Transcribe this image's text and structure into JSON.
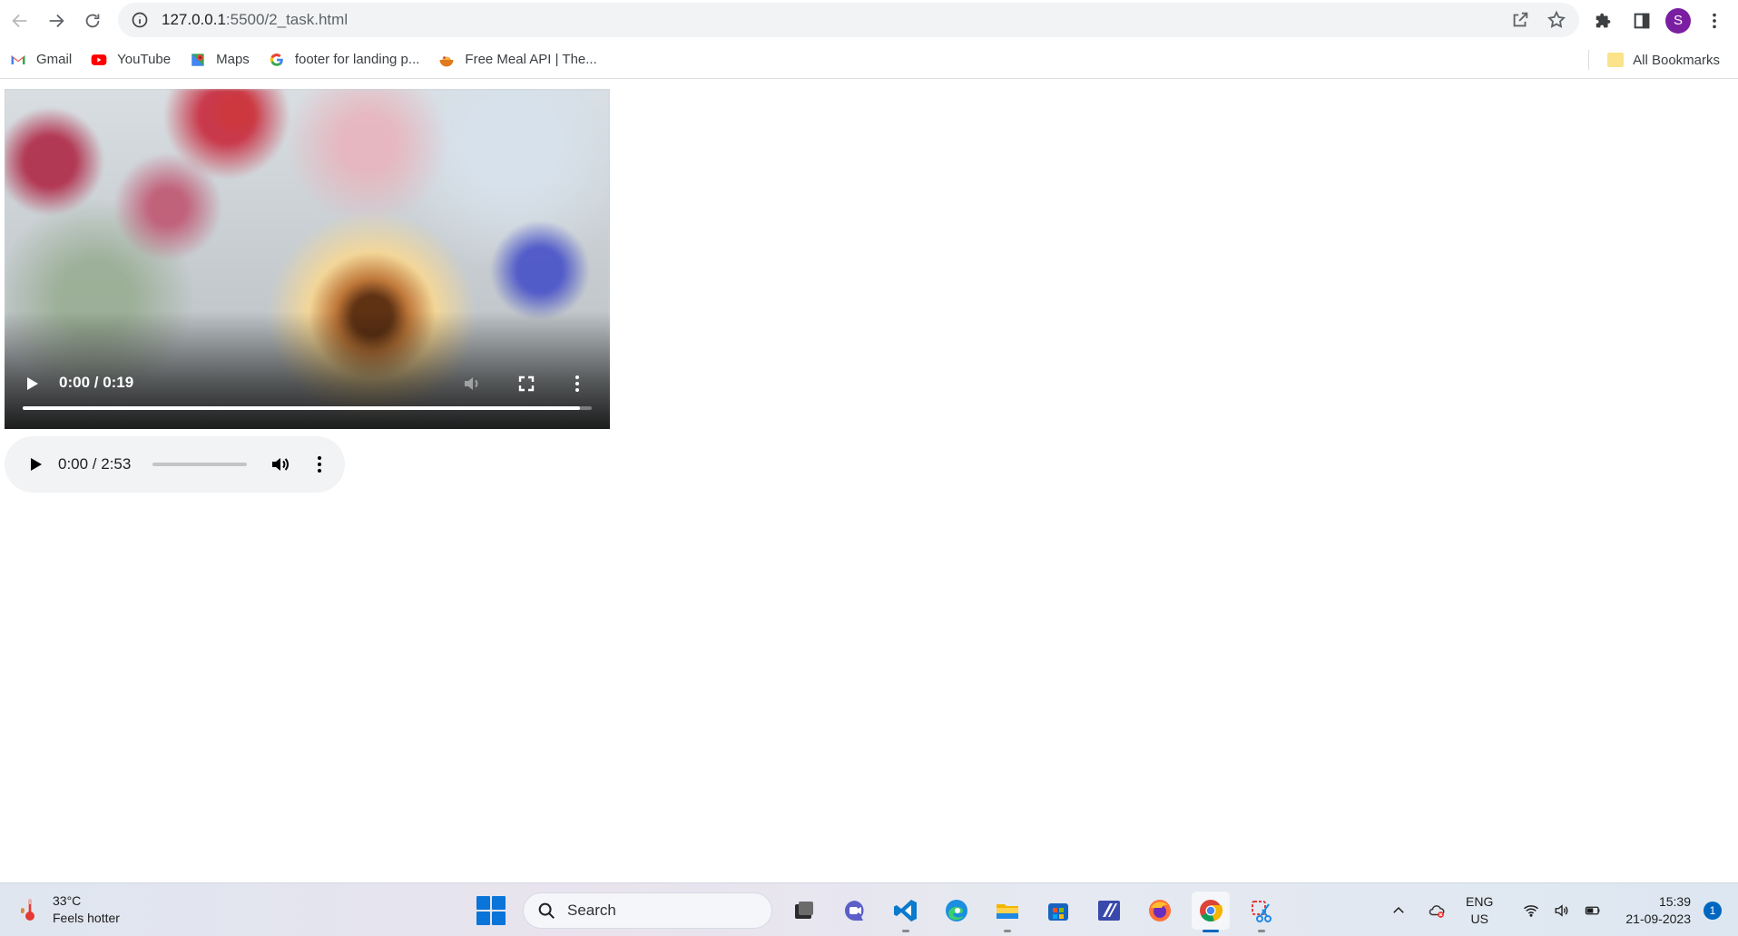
{
  "browser": {
    "url_host": "127.0.0.1",
    "url_rest": ":5500/2_task.html",
    "profile_initial": "S"
  },
  "bookmarks": {
    "items": [
      {
        "label": "Gmail",
        "icon": "gmail-icon"
      },
      {
        "label": "YouTube",
        "icon": "youtube-icon"
      },
      {
        "label": "Maps",
        "icon": "maps-icon"
      },
      {
        "label": "footer for landing p...",
        "icon": "google-icon"
      },
      {
        "label": "Free Meal API | The...",
        "icon": "meal-icon"
      }
    ],
    "all_bookmarks": "All Bookmarks"
  },
  "video": {
    "time": "0:00 / 0:19",
    "progress_fraction": 0.98
  },
  "audio": {
    "time": "0:00 / 2:53",
    "progress_fraction": 0.0
  },
  "taskbar": {
    "temperature": "33°C",
    "weather_text": "Feels hotter",
    "search_label": "Search",
    "lang_line1": "ENG",
    "lang_line2": "US",
    "time": "15:39",
    "date": "21-09-2023",
    "notification_count": "1"
  },
  "colors": {
    "accent": "#0067c0",
    "profile": "#7b1fa2"
  }
}
